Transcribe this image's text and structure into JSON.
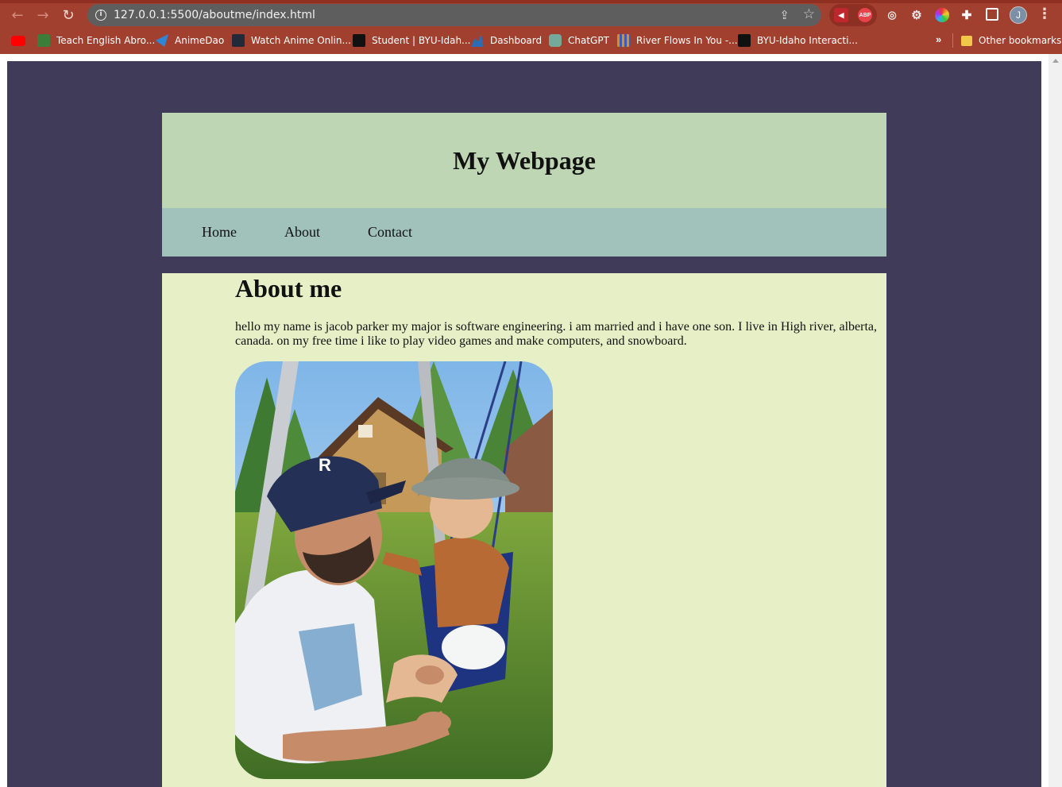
{
  "browser": {
    "url": "127.0.0.1:5500/aboutme/index.html",
    "profile_initial": "J",
    "extensions": [
      {
        "name": "volume-icon",
        "color": "#c0272d",
        "label": "◀"
      },
      {
        "name": "adblock-plus-icon",
        "color": "#e8424a",
        "label": "ABP"
      },
      {
        "name": "fingerprint-icon",
        "color": "#6d6d6d",
        "label": ""
      },
      {
        "name": "gear-icon",
        "color": "#8a8a8a",
        "label": ""
      },
      {
        "name": "color-wheel-icon",
        "color": "#d04080",
        "label": ""
      },
      {
        "name": "puzzle-icon",
        "color": "#ffffff",
        "label": ""
      }
    ],
    "bookmarks": [
      {
        "label": "",
        "icon": "youtube-icon",
        "color": "#ff0000"
      },
      {
        "label": "Teach English Abro...",
        "icon": "tea-icon",
        "color": "#3d7d3a"
      },
      {
        "label": "AnimeDao",
        "icon": "animedao-icon",
        "color": "#2f86d6"
      },
      {
        "label": "Watch Anime Onlin...",
        "icon": "anime-icon",
        "color": "#222a3a"
      },
      {
        "label": "Student | BYU-Idah...",
        "icon": "byu-icon",
        "color": "#111111"
      },
      {
        "label": "Dashboard",
        "icon": "dashboard-icon",
        "color": "#2a6db5"
      },
      {
        "label": "ChatGPT",
        "icon": "chatgpt-icon",
        "color": "#74aa9c"
      },
      {
        "label": "River Flows In You -...",
        "icon": "piano-icon",
        "color": "#d88c2a"
      },
      {
        "label": "BYU-Idaho Interacti...",
        "icon": "byu-icon",
        "color": "#111111"
      }
    ],
    "other_bookmarks": "Other bookmarks"
  },
  "site": {
    "title": "My Webpage",
    "nav": [
      "Home",
      "About",
      "Contact"
    ],
    "about_heading": "About me",
    "about_text": "hello my name is jacob parker my major is software engineering. i am married and i have one son. I live in High river, alberta, canada. on my free time i like to play video games and make computers, and snowboard."
  },
  "colors": {
    "page_background": "#413b5a",
    "header_background": "#bfd6b4",
    "nav_background": "#a1c2bb",
    "main_background": "#e6efc6",
    "browser_chrome": "#a2402f"
  }
}
